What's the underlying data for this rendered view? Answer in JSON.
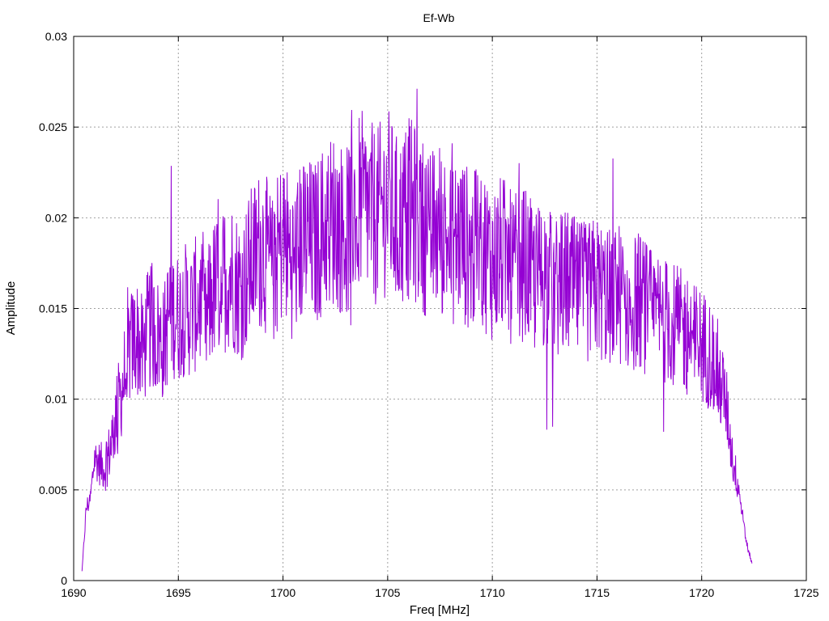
{
  "chart_data": {
    "type": "line",
    "title": "Ef-Wb",
    "xlabel": "Freq [MHz]",
    "ylabel": "Amplitude",
    "xlim": [
      1690,
      1725
    ],
    "ylim": [
      0,
      0.03
    ],
    "x_ticks": [
      "1690",
      "1695",
      "1700",
      "1705",
      "1710",
      "1715",
      "1720",
      "1725"
    ],
    "y_ticks": [
      "0",
      "0.005",
      "0.01",
      "0.015",
      "0.02",
      "0.025",
      "0.03"
    ],
    "grid": true,
    "legend": "none",
    "series": [
      {
        "color": "#9400d3",
        "x": [
          1690.4,
          1690.6,
          1690.8,
          1691.0,
          1691.2,
          1691.5,
          1691.8,
          1692.0,
          1692.3,
          1692.6,
          1693.0,
          1693.3,
          1693.6,
          1694.0,
          1694.3,
          1694.6,
          1695.0,
          1695.3,
          1695.6,
          1696.0,
          1696.3,
          1696.6,
          1697.0,
          1697.5,
          1698.0,
          1698.5,
          1699.0,
          1699.5,
          1700.0,
          1700.5,
          1701.0,
          1701.5,
          1702.0,
          1702.5,
          1703.0,
          1703.5,
          1704.0,
          1704.5,
          1705.0,
          1705.5,
          1706.0,
          1706.5,
          1707.0,
          1707.5,
          1708.0,
          1708.5,
          1709.0,
          1709.5,
          1710.0,
          1710.5,
          1711.0,
          1711.5,
          1712.0,
          1712.5,
          1713.0,
          1713.5,
          1714.0,
          1714.5,
          1715.0,
          1715.5,
          1716.0,
          1716.5,
          1717.0,
          1717.5,
          1718.0,
          1718.5,
          1719.0,
          1719.5,
          1720.0,
          1720.4,
          1720.8,
          1721.2,
          1721.5,
          1721.8,
          1722.0,
          1722.2,
          1722.4
        ],
        "y": [
          0.0005,
          0.004,
          0.0045,
          0.0068,
          0.0065,
          0.0062,
          0.0075,
          0.009,
          0.0105,
          0.0125,
          0.0135,
          0.0125,
          0.014,
          0.0135,
          0.013,
          0.015,
          0.0145,
          0.015,
          0.0148,
          0.0155,
          0.014,
          0.0158,
          0.0165,
          0.017,
          0.016,
          0.0175,
          0.0185,
          0.017,
          0.019,
          0.0175,
          0.019,
          0.0185,
          0.0195,
          0.02,
          0.019,
          0.021,
          0.0205,
          0.02,
          0.021,
          0.0195,
          0.0205,
          0.02,
          0.019,
          0.0195,
          0.0185,
          0.019,
          0.018,
          0.0185,
          0.0175,
          0.018,
          0.017,
          0.0175,
          0.0165,
          0.017,
          0.016,
          0.0165,
          0.016,
          0.0158,
          0.0162,
          0.0155,
          0.016,
          0.015,
          0.0155,
          0.0148,
          0.0145,
          0.0142,
          0.0138,
          0.0135,
          0.013,
          0.0125,
          0.0115,
          0.0095,
          0.0065,
          0.005,
          0.003,
          0.0018,
          0.001
        ]
      }
    ]
  }
}
